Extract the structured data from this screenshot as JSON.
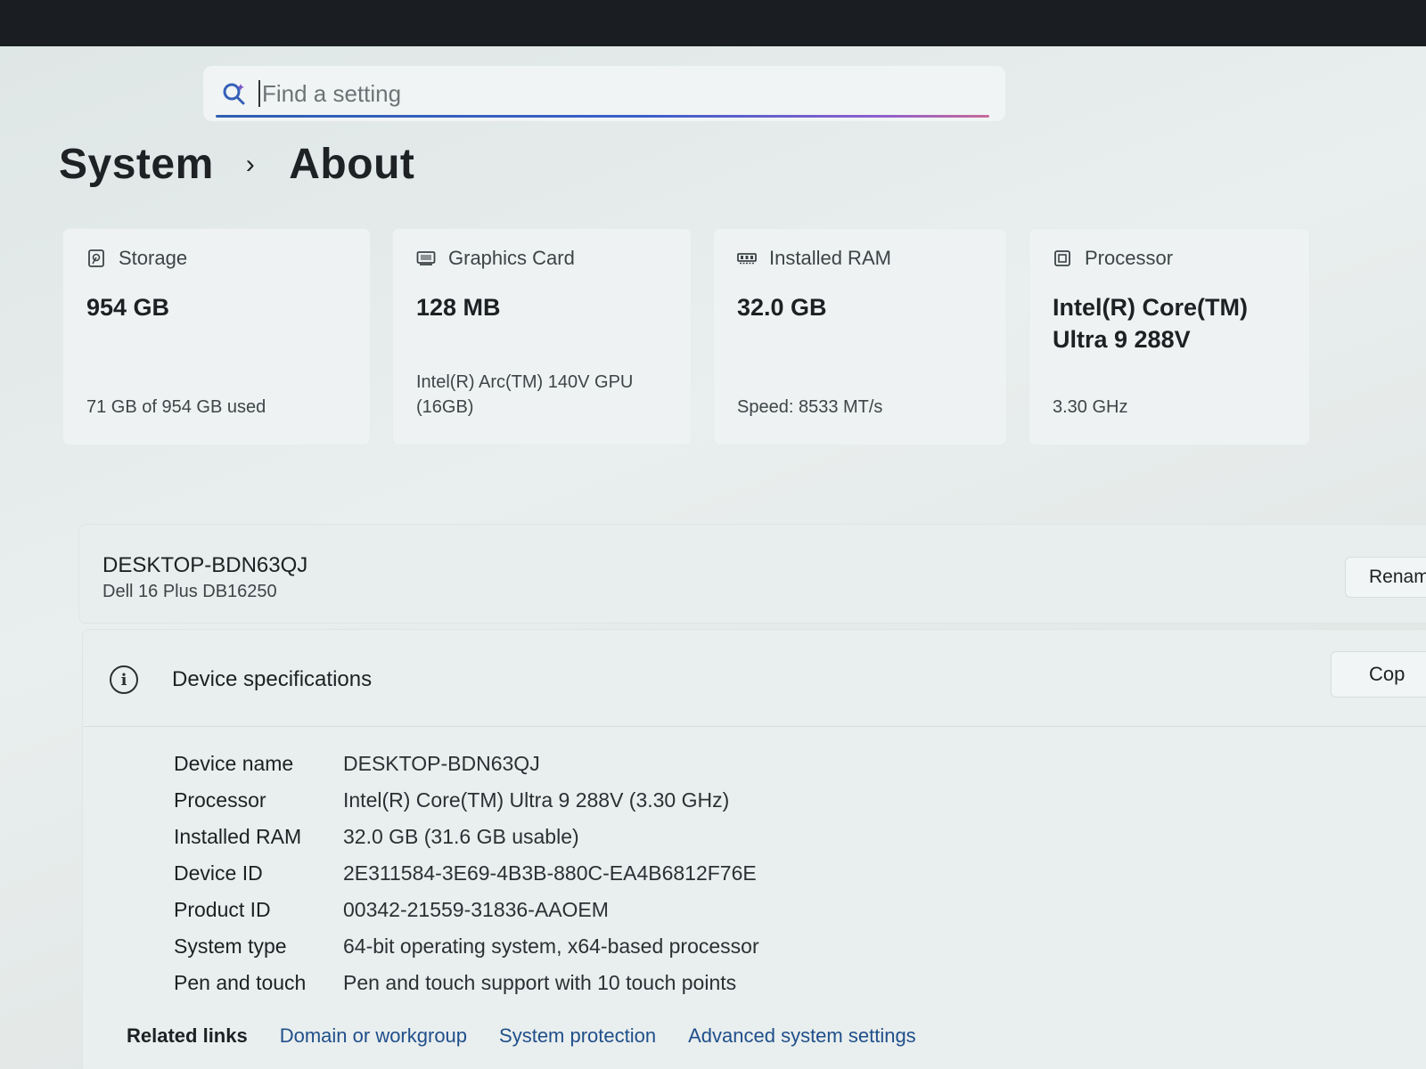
{
  "search": {
    "placeholder": "Find a setting"
  },
  "breadcrumb": {
    "parent": "System",
    "separator": "›",
    "current": "About"
  },
  "cards": [
    {
      "icon": "storage-icon",
      "title": "Storage",
      "value": "954 GB",
      "sub": "71 GB of 954 GB used"
    },
    {
      "icon": "graphics-card-icon",
      "title": "Graphics Card",
      "value": "128 MB",
      "sub": "Intel(R) Arc(TM) 140V GPU (16GB)"
    },
    {
      "icon": "ram-icon",
      "title": "Installed RAM",
      "value": "32.0 GB",
      "sub": "Speed: 8533 MT/s"
    },
    {
      "icon": "processor-icon",
      "title": "Processor",
      "value": "Intel(R) Core(TM) Ultra 9 288V",
      "sub": "3.30 GHz"
    }
  ],
  "device": {
    "name": "DESKTOP-BDN63QJ",
    "model": "Dell 16 Plus DB16250",
    "rename_label": "Renam"
  },
  "specs": {
    "title": "Device specifications",
    "copy_label": "Cop",
    "rows": [
      {
        "label": "Device name",
        "value": "DESKTOP-BDN63QJ"
      },
      {
        "label": "Processor",
        "value": "Intel(R) Core(TM) Ultra 9 288V (3.30 GHz)"
      },
      {
        "label": "Installed RAM",
        "value": "32.0 GB (31.6 GB usable)"
      },
      {
        "label": "Device ID",
        "value": "2E311584-3E69-4B3B-880C-EA4B6812F76E"
      },
      {
        "label": "Product ID",
        "value": "00342-21559-31836-AAOEM"
      },
      {
        "label": "System type",
        "value": "64-bit operating system, x64-based processor"
      },
      {
        "label": "Pen and touch",
        "value": "Pen and touch support with 10 touch points"
      }
    ]
  },
  "related": {
    "title": "Related links",
    "links": [
      "Domain or workgroup",
      "System protection",
      "Advanced system settings"
    ]
  }
}
